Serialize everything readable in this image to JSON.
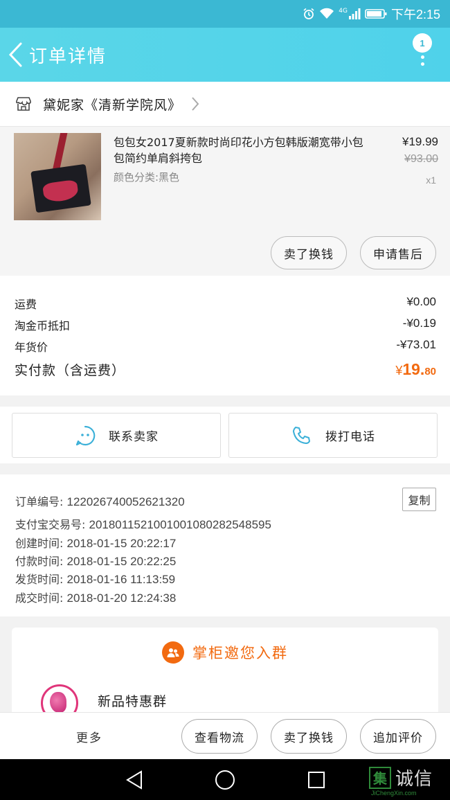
{
  "status_bar": {
    "network": "4G",
    "time": "下午2:15"
  },
  "nav": {
    "title": "订单详情",
    "badge": "1"
  },
  "shop": {
    "name": "黛妮家《清新学院风》"
  },
  "product": {
    "title": "包包女2017夏新款时尚印花小方包韩版潮宽带小包包简约单肩斜挎包",
    "sku": "颜色分类:黑色",
    "price": "¥19.99",
    "original_price": "¥93.00",
    "quantity": "x1",
    "buttons": {
      "exchange": "卖了换钱",
      "after_sale": "申请售后"
    }
  },
  "costs": {
    "shipping_label": "运费",
    "shipping_value": "¥0.00",
    "coin_label": "淘金币抵扣",
    "coin_value": "-¥0.19",
    "holiday_label": "年货价",
    "holiday_value": "-¥73.01",
    "total_label": "实付款（含运费）",
    "total_currency": "¥",
    "total_int": "19.",
    "total_dec": "80"
  },
  "contact": {
    "seller": "联系卖家",
    "call": "拨打电话"
  },
  "order_info": {
    "order_no_label": "订单编号: ",
    "order_no": "1220267400526213​20",
    "alipay_label": "支付宝交易号: ",
    "alipay_no": "2018011521001001080282548595",
    "created_label": "创建时间: ",
    "created": "2018-01-15 20:22:17",
    "paid_label": "付款时间: ",
    "paid": "2018-01-15 20:22:25",
    "shipped_label": "发货时间: ",
    "shipped": "2018-01-16 11:13:59",
    "completed_label": "成交时间: ",
    "completed": "2018-01-20 12:24:38",
    "copy_label": "复制"
  },
  "group": {
    "heading": "掌柜邀您入群",
    "name": "新品特惠群"
  },
  "actions": {
    "more": "更多",
    "logistics": "查看物流",
    "exchange": "卖了换钱",
    "review": "追加评价"
  },
  "watermark": {
    "mark": "集",
    "text": "诚信",
    "url": "JiChengXin.com"
  },
  "colors": {
    "accent": "#f26a10",
    "header": "#4fd2ea",
    "contact_icon": "#3bb0d8"
  }
}
